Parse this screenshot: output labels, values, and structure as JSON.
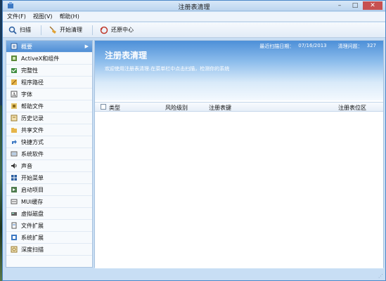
{
  "window": {
    "title": "注册表清理"
  },
  "menubar": {
    "items": [
      "文件(F)",
      "视图(V)",
      "帮助(H)"
    ]
  },
  "toolbar": {
    "scan": "扫描",
    "start_clean": "开始清理",
    "restore_center": "还原中心"
  },
  "sidebar": {
    "items": [
      {
        "label": "概要",
        "icon": "overview-icon"
      },
      {
        "label": "ActiveX和组件",
        "icon": "activex-icon"
      },
      {
        "label": "完整性",
        "icon": "integrity-icon"
      },
      {
        "label": "程序路径",
        "icon": "program-path-icon"
      },
      {
        "label": "字体",
        "icon": "font-icon"
      },
      {
        "label": "帮助文件",
        "icon": "help-file-icon"
      },
      {
        "label": "历史记录",
        "icon": "history-icon"
      },
      {
        "label": "共享文件",
        "icon": "shared-file-icon"
      },
      {
        "label": "快捷方式",
        "icon": "shortcut-icon"
      },
      {
        "label": "系统软件",
        "icon": "system-software-icon"
      },
      {
        "label": "声音",
        "icon": "sound-icon"
      },
      {
        "label": "开始菜单",
        "icon": "start-menu-icon"
      },
      {
        "label": "启动项目",
        "icon": "startup-icon"
      },
      {
        "label": "MUI缓存",
        "icon": "mui-cache-icon"
      },
      {
        "label": "虚拟磁盘",
        "icon": "virtual-disk-icon"
      },
      {
        "label": "文件扩展",
        "icon": "file-extension-icon"
      },
      {
        "label": "系统扩展",
        "icon": "system-extension-icon"
      },
      {
        "label": "深度扫描",
        "icon": "deep-scan-icon"
      }
    ]
  },
  "banner": {
    "title": "注册表清理",
    "description": "欢迎使用注册表清理.在菜单栏中点击扫描，检测你的系统",
    "last_scan_label": "最近扫描日期：",
    "last_scan_value": "07/16/2013",
    "issues_label": "清理问题：",
    "issues_value": "327"
  },
  "table": {
    "columns": [
      "类型",
      "风险级别",
      "注册表键",
      "注册表位区"
    ]
  },
  "colors": {
    "accent": "#4f8fd6",
    "close": "#c75050"
  }
}
